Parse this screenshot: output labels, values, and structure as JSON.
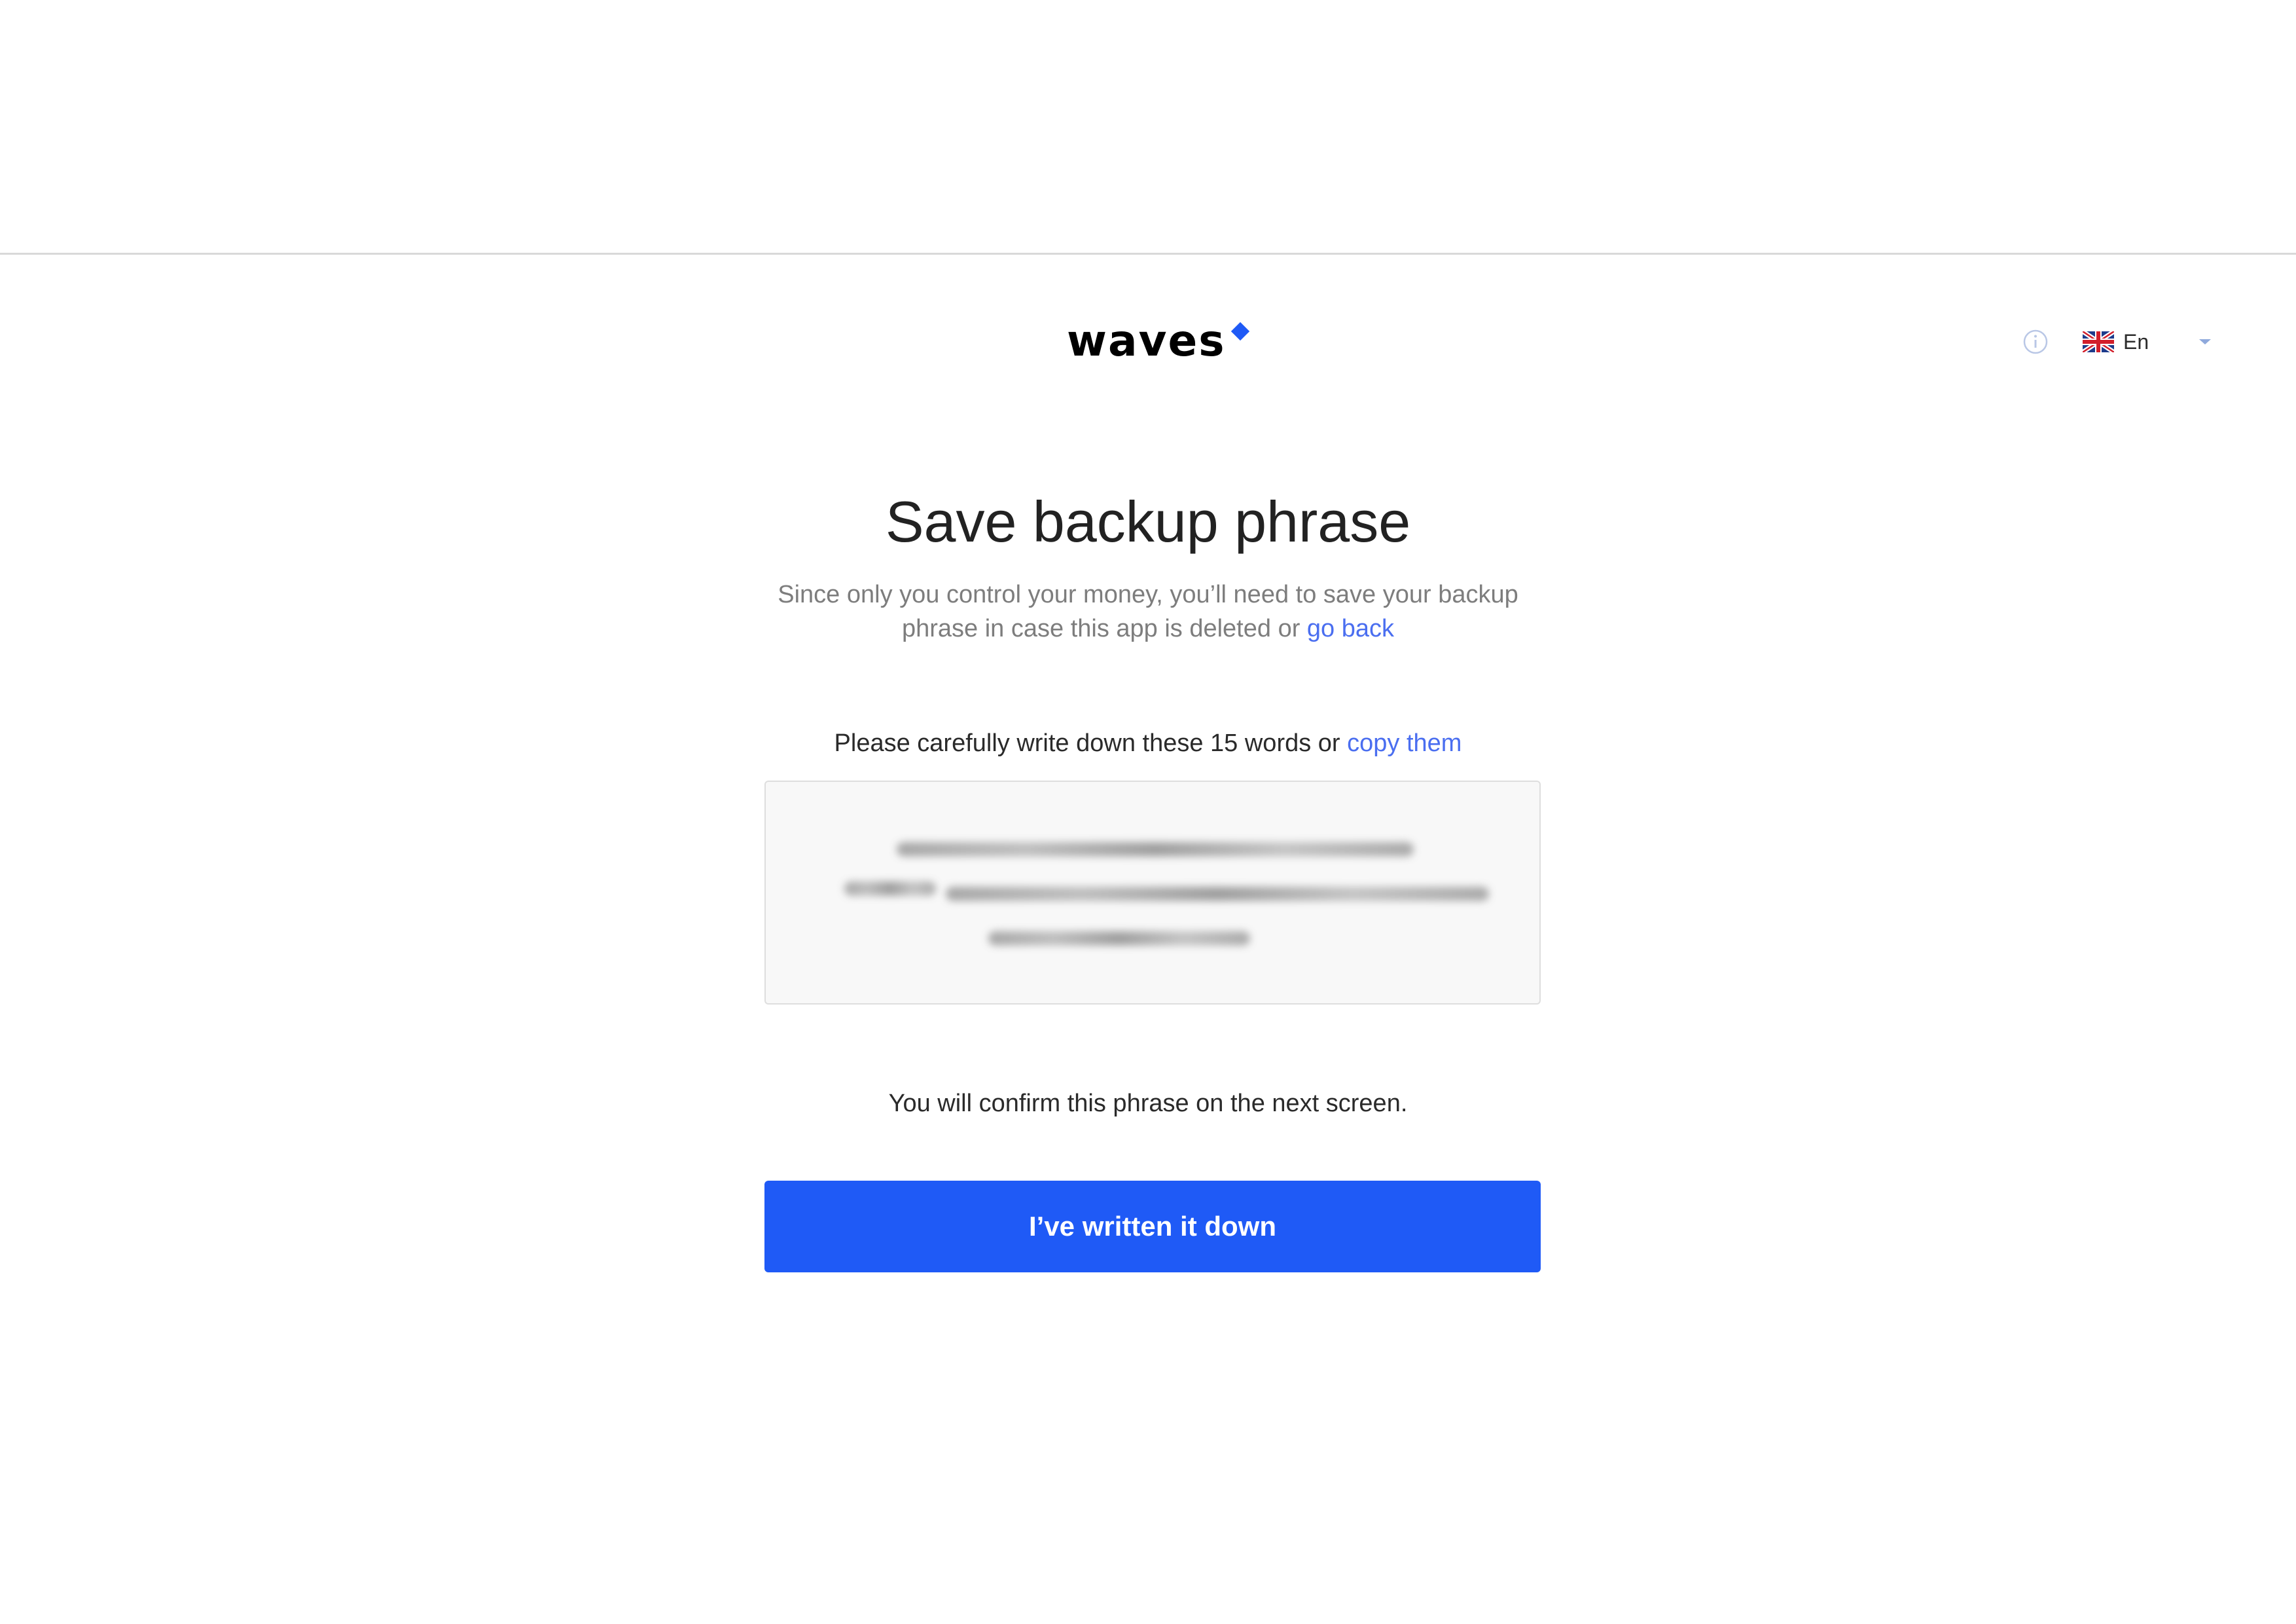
{
  "header": {
    "logo_text": "waves",
    "language_label": "En",
    "icons": {
      "info": "info-icon",
      "flag": "uk-flag-icon",
      "dropdown": "chevron-down-icon",
      "logo_mark": "diamond-icon"
    },
    "colors": {
      "brand": "#1f5af6"
    }
  },
  "main": {
    "title": "Save backup phrase",
    "subtitle_text": "Since only you control your money, you’ll need to save your backup phrase in case this app is deleted or",
    "go_back_link": "go back",
    "instruction_text": "Please carefully write down these 15 words  or",
    "copy_link": "copy them",
    "confirm_note": "You will confirm this phrase on the next screen.",
    "primary_button": "I’ve written it down",
    "colors": {
      "link": "#4a6ef0",
      "button": "#1f5af6"
    }
  }
}
